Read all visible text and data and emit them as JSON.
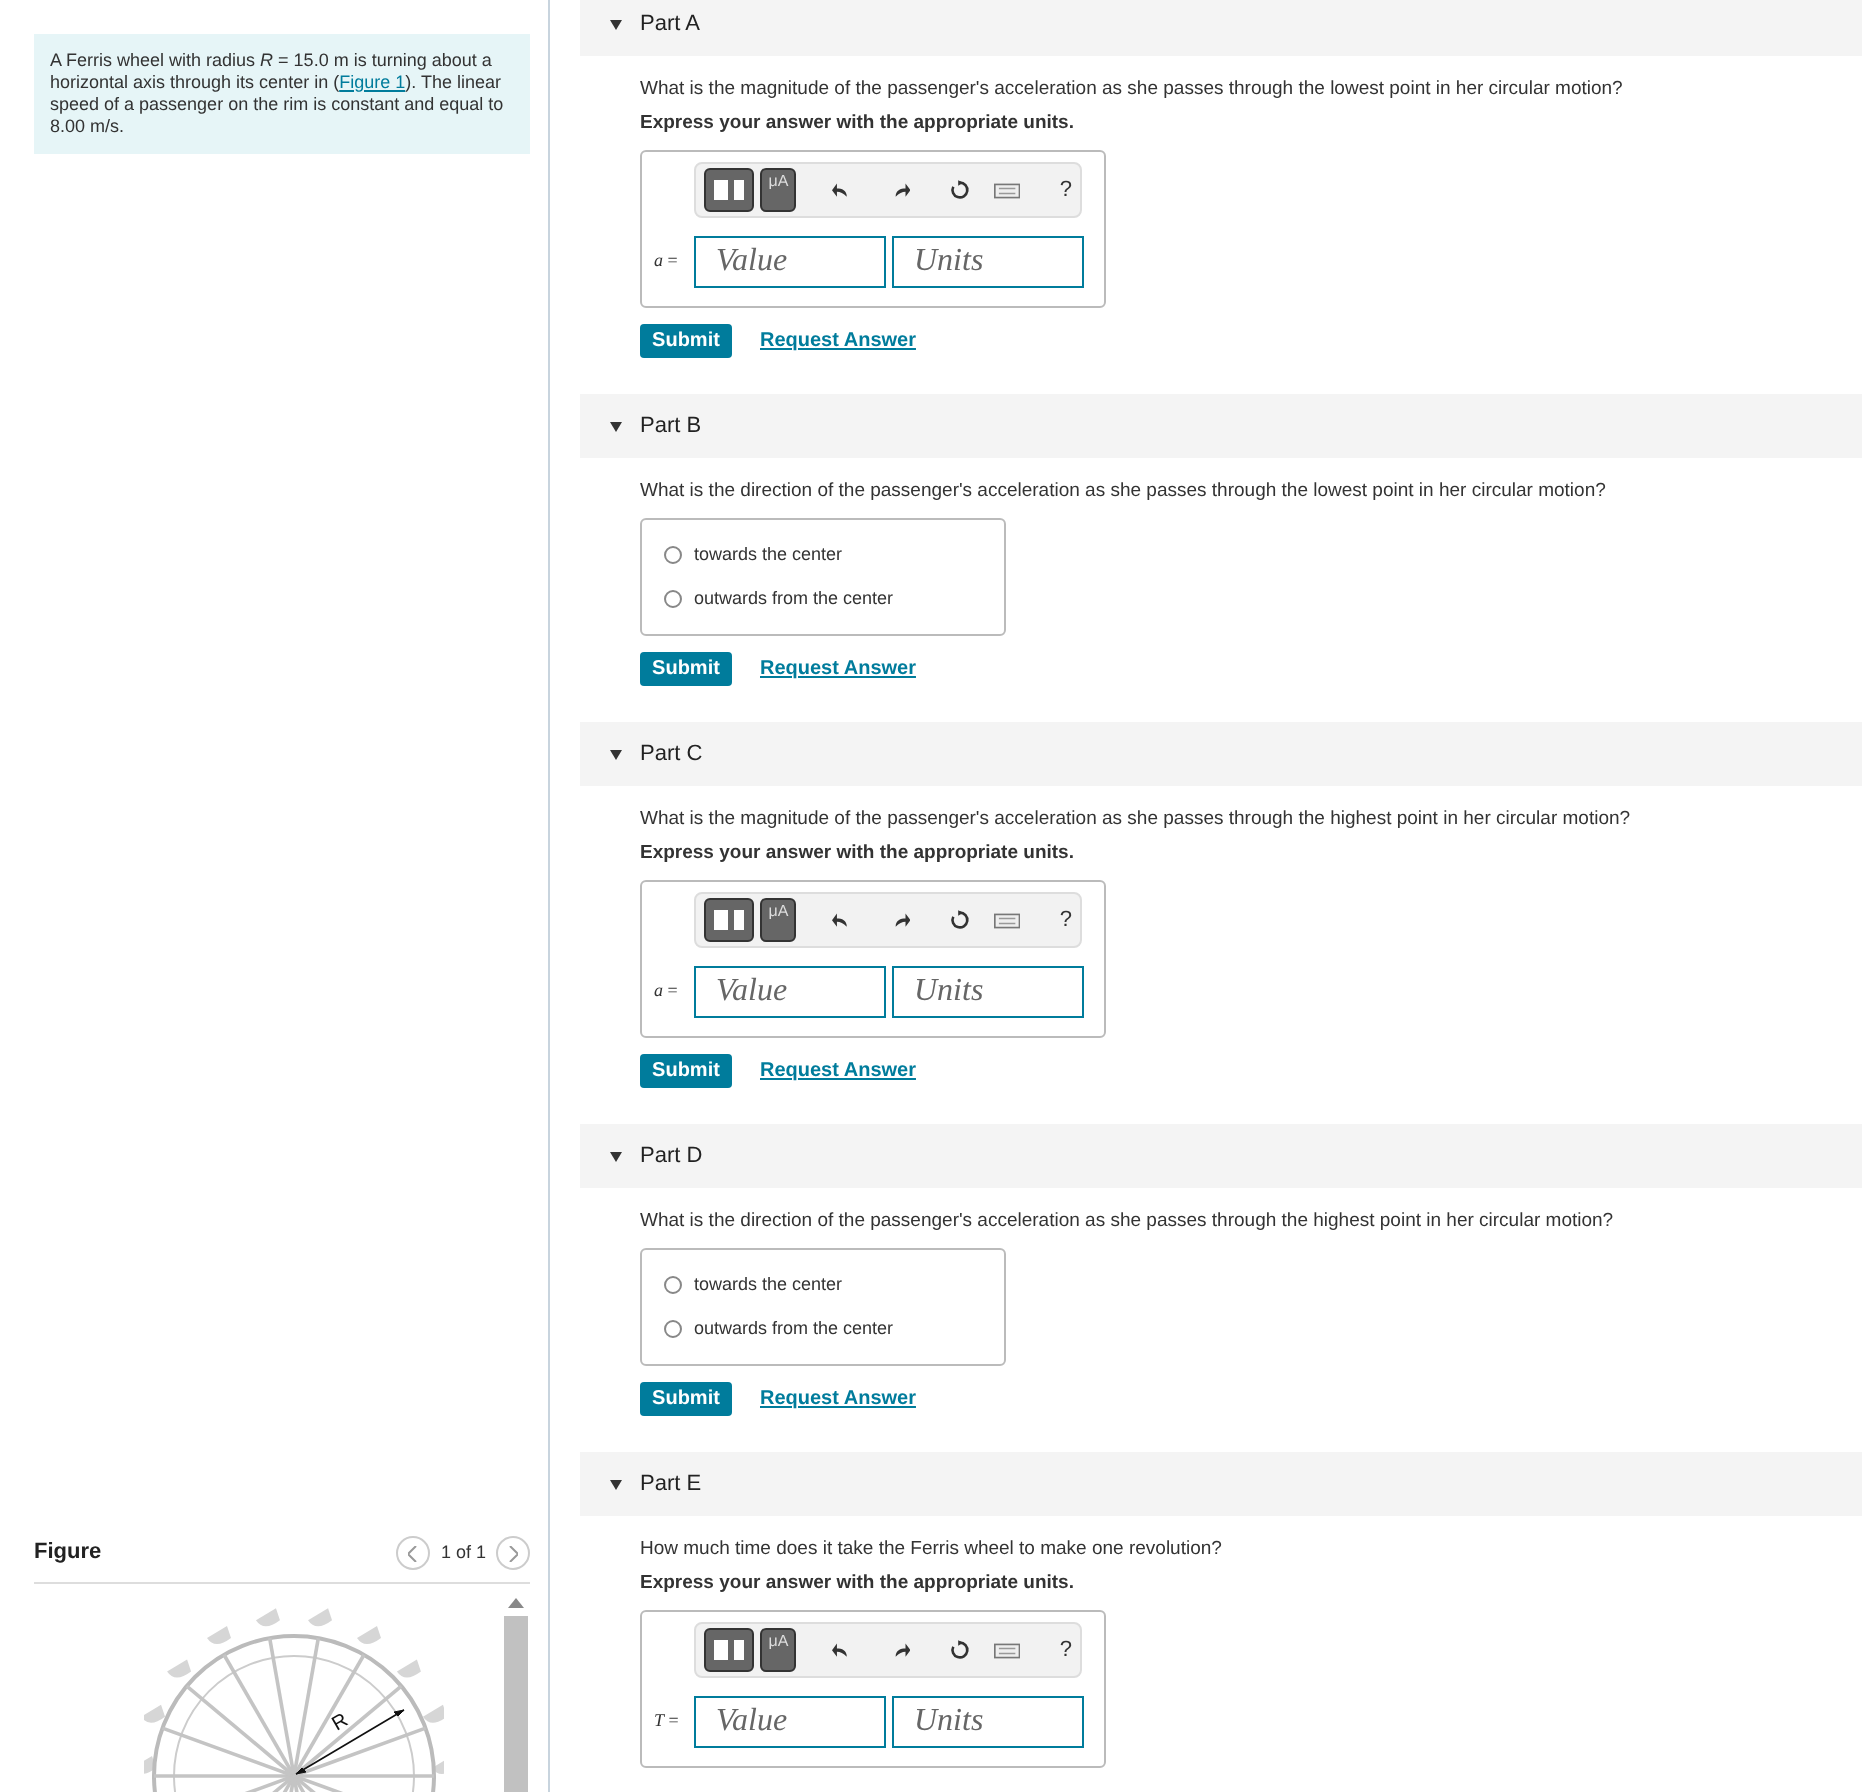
{
  "problem": {
    "text_before": "A Ferris wheel with radius *R* = 15.0 m is turning about a horizontal axis through its center in (",
    "link": "Figure 1",
    "text_after": "). The linear speed of a passenger on the rim is constant and equal to 8.00 m/s."
  },
  "figure": {
    "title": "Figure",
    "pager": "1 of 1",
    "radius_label": "R"
  },
  "parts": [
    {
      "kind": "math",
      "title": "Part A",
      "expanded": true,
      "question": "What is the magnitude of the passenger's acceleration as she passes through the lowest point in her circular motion?",
      "instruction": "Express your answer with the appropriate units.",
      "toolbar": {
        "units_button": "μA",
        "help": "?"
      },
      "variable": "*a* =",
      "value_placeholder": "Value",
      "units_placeholder": "Units",
      "submit": "Submit",
      "request": "Request Answer"
    },
    {
      "kind": "choice",
      "title": "Part B",
      "expanded": true,
      "question": "What is the direction of the passenger's acceleration as she passes through the lowest point in her circular motion?",
      "options": [
        {
          "label": "towards the center",
          "selected": false
        },
        {
          "label": "outwards from the center",
          "selected": false
        }
      ],
      "submit": "Submit",
      "request": "Request Answer"
    },
    {
      "kind": "math",
      "title": "Part C",
      "expanded": true,
      "question": "What is the magnitude of the passenger's acceleration as she passes through the highest point in her circular motion?",
      "instruction": "Express your answer with the appropriate units.",
      "toolbar": {
        "units_button": "μA",
        "help": "?"
      },
      "variable": "*a* =",
      "value_placeholder": "Value",
      "units_placeholder": "Units",
      "submit": "Submit",
      "request": "Request Answer"
    },
    {
      "kind": "choice",
      "title": "Part D",
      "expanded": true,
      "question": "What is the direction of the passenger's acceleration as she passes through the highest point in her circular motion?",
      "options": [
        {
          "label": "towards the center",
          "selected": false
        },
        {
          "label": "outwards from the center",
          "selected": false
        }
      ],
      "submit": "Submit",
      "request": "Request Answer"
    },
    {
      "kind": "math",
      "title": "Part E",
      "expanded": true,
      "question": "How much time does it take the Ferris wheel to make one revolution?",
      "instruction": "Express your answer with the appropriate units.",
      "toolbar": {
        "units_button": "μA",
        "help": "?"
      },
      "variable": "*T* =",
      "value_placeholder": "Value",
      "units_placeholder": "Units"
    }
  ]
}
